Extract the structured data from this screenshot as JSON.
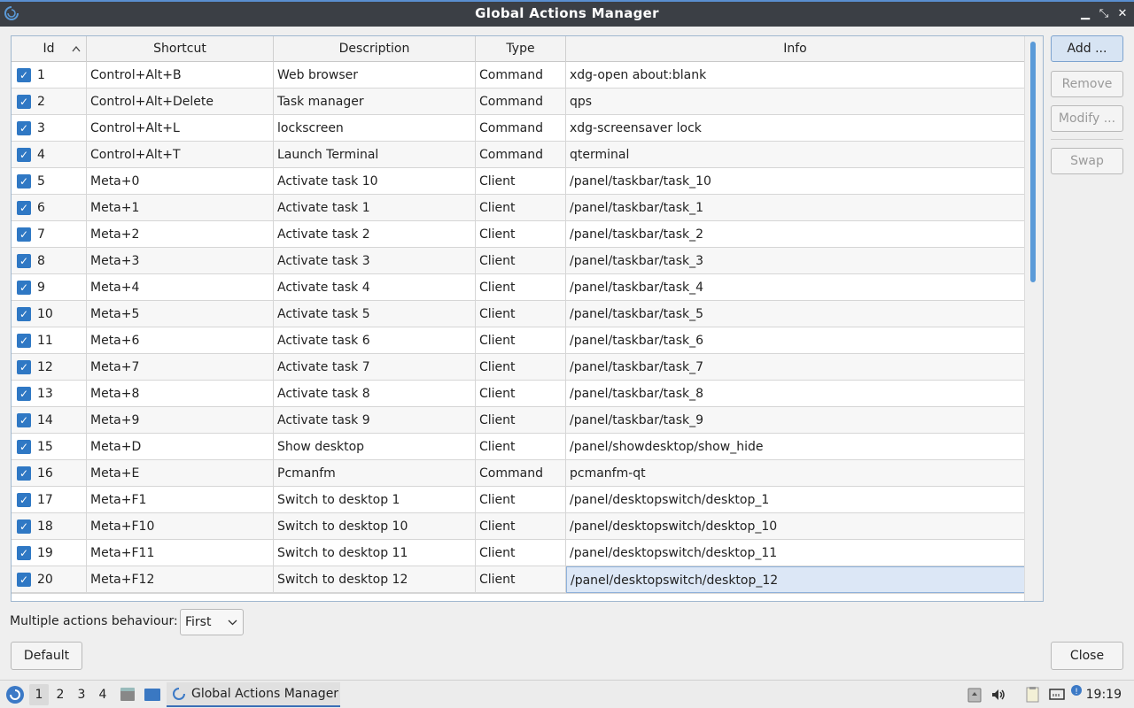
{
  "window": {
    "title": "Global Actions Manager",
    "buttons": {
      "minimize": "▁",
      "maximize": "⤡",
      "close": "✕"
    }
  },
  "table": {
    "columns": [
      "Id",
      "Shortcut",
      "Description",
      "Type",
      "Info"
    ],
    "sort_indicator": "^",
    "rows": [
      {
        "id": "1",
        "shortcut": "Control+Alt+B",
        "description": "Web browser",
        "type": "Command",
        "info": "xdg-open about:blank",
        "checked": true
      },
      {
        "id": "2",
        "shortcut": "Control+Alt+Delete",
        "description": "Task manager",
        "type": "Command",
        "info": "qps",
        "checked": true
      },
      {
        "id": "3",
        "shortcut": "Control+Alt+L",
        "description": "lockscreen",
        "type": "Command",
        "info": "xdg-screensaver lock",
        "checked": true
      },
      {
        "id": "4",
        "shortcut": "Control+Alt+T",
        "description": "Launch Terminal",
        "type": "Command",
        "info": "qterminal",
        "checked": true
      },
      {
        "id": "5",
        "shortcut": "Meta+0",
        "description": "Activate task 10",
        "type": "Client",
        "info": "/panel/taskbar/task_10",
        "checked": true
      },
      {
        "id": "6",
        "shortcut": "Meta+1",
        "description": "Activate task 1",
        "type": "Client",
        "info": "/panel/taskbar/task_1",
        "checked": true
      },
      {
        "id": "7",
        "shortcut": "Meta+2",
        "description": "Activate task 2",
        "type": "Client",
        "info": "/panel/taskbar/task_2",
        "checked": true
      },
      {
        "id": "8",
        "shortcut": "Meta+3",
        "description": "Activate task 3",
        "type": "Client",
        "info": "/panel/taskbar/task_3",
        "checked": true
      },
      {
        "id": "9",
        "shortcut": "Meta+4",
        "description": "Activate task 4",
        "type": "Client",
        "info": "/panel/taskbar/task_4",
        "checked": true
      },
      {
        "id": "10",
        "shortcut": "Meta+5",
        "description": "Activate task 5",
        "type": "Client",
        "info": "/panel/taskbar/task_5",
        "checked": true
      },
      {
        "id": "11",
        "shortcut": "Meta+6",
        "description": "Activate task 6",
        "type": "Client",
        "info": "/panel/taskbar/task_6",
        "checked": true
      },
      {
        "id": "12",
        "shortcut": "Meta+7",
        "description": "Activate task 7",
        "type": "Client",
        "info": "/panel/taskbar/task_7",
        "checked": true
      },
      {
        "id": "13",
        "shortcut": "Meta+8",
        "description": "Activate task 8",
        "type": "Client",
        "info": "/panel/taskbar/task_8",
        "checked": true
      },
      {
        "id": "14",
        "shortcut": "Meta+9",
        "description": "Activate task 9",
        "type": "Client",
        "info": "/panel/taskbar/task_9",
        "checked": true
      },
      {
        "id": "15",
        "shortcut": "Meta+D",
        "description": "Show desktop",
        "type": "Client",
        "info": "/panel/showdesktop/show_hide",
        "checked": true
      },
      {
        "id": "16",
        "shortcut": "Meta+E",
        "description": "Pcmanfm",
        "type": "Command",
        "info": "pcmanfm-qt",
        "checked": true
      },
      {
        "id": "17",
        "shortcut": "Meta+F1",
        "description": "Switch to desktop 1",
        "type": "Client",
        "info": "/panel/desktopswitch/desktop_1",
        "checked": true
      },
      {
        "id": "18",
        "shortcut": "Meta+F10",
        "description": "Switch to desktop 10",
        "type": "Client",
        "info": "/panel/desktopswitch/desktop_10",
        "checked": true
      },
      {
        "id": "19",
        "shortcut": "Meta+F11",
        "description": "Switch to desktop 11",
        "type": "Client",
        "info": "/panel/desktopswitch/desktop_11",
        "checked": true
      },
      {
        "id": "20",
        "shortcut": "Meta+F12",
        "description": "Switch to desktop 12",
        "type": "Client",
        "info": "/panel/desktopswitch/desktop_12",
        "checked": true,
        "selected": true
      }
    ],
    "checkmark": "✓"
  },
  "side_buttons": {
    "add": "Add ...",
    "remove": "Remove",
    "modify": "Modify ...",
    "swap": "Swap"
  },
  "bottom": {
    "multiple_label": "Multiple actions behaviour:",
    "multiple_value": "First",
    "default": "Default",
    "close": "Close"
  },
  "taskbar": {
    "desktops": [
      "1",
      "2",
      "3",
      "4"
    ],
    "active_desktop": "1",
    "window_label": "Global Actions Manager",
    "clock": "19:19"
  },
  "colors": {
    "accent": "#2f78c4",
    "selection": "#dce7f6",
    "titlebar": "#3b3f45"
  }
}
